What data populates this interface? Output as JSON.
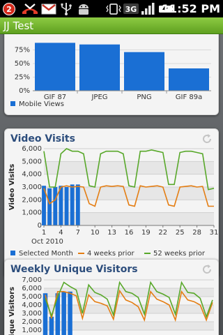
{
  "status_bar": {
    "notification_count": "2",
    "network_type": "3G",
    "time": "11:52 PM",
    "icons": [
      "notification-badge-icon",
      "missed-call-icon",
      "gmail-icon",
      "usb-icon",
      "android-debug-icon",
      "vibrate-icon",
      "3g-icon",
      "signal-icon",
      "battery-icon"
    ]
  },
  "app": {
    "title": "JJ Test"
  },
  "cards": {
    "mobile_views": {
      "legend": "Mobile Views"
    },
    "video_visits": {
      "title": "Video Visits",
      "month_label": "Oct 2010",
      "legend": [
        "Selected Month",
        "4 weeks prior",
        "52 weeks prior"
      ]
    },
    "weekly_visitors": {
      "title": "Weekly Unique Visitors"
    }
  },
  "colors": {
    "bar_blue": "#1a6fd4",
    "orange": "#e47d12",
    "green": "#58a82a",
    "title_blue": "#2c4d7c",
    "app_bar_green": "#6fb22b"
  },
  "chart_data": [
    {
      "type": "bar",
      "categories": [
        "GIF 87",
        "JPEG",
        "PNG",
        "GIF 89a"
      ],
      "series": [
        {
          "name": "Mobile Views",
          "values": [
            88,
            85,
            71,
            41
          ]
        }
      ],
      "yticks": [
        "0%",
        "25%",
        "50%",
        "75%"
      ],
      "ylim": [
        0,
        100
      ],
      "legend": "bottom-left"
    },
    {
      "type": "line",
      "title": "Video Visits",
      "ylabel": "Video Visits",
      "xlabel": "Oct 2010",
      "x": [
        1,
        2,
        3,
        4,
        5,
        6,
        7,
        8,
        9,
        10,
        11,
        12,
        13,
        14,
        15,
        16,
        17,
        18,
        19,
        20,
        21,
        22,
        23,
        24,
        25,
        26,
        27,
        28,
        29,
        30,
        31
      ],
      "xticks": [
        "1",
        "4",
        "7",
        "10",
        "13",
        "16",
        "19",
        "22",
        "25",
        "28",
        "31"
      ],
      "yticks": [
        "0",
        "1,000",
        "2,000",
        "3,000",
        "4,000",
        "5,000",
        "6,000"
      ],
      "ylim": [
        0,
        6000
      ],
      "series": [
        {
          "name": "Selected Month",
          "kind": "bar",
          "values": [
            3100,
            2900,
            3000,
            3100,
            3000,
            3200,
            3200
          ]
        },
        {
          "name": "4 weeks prior",
          "kind": "line",
          "values": [
            2900,
            1700,
            2000,
            3000,
            3100,
            3000,
            3050,
            3000,
            1700,
            1500,
            3000,
            3100,
            3050,
            3100,
            3050,
            1600,
            1500,
            3100,
            3000,
            3050,
            3100,
            3000,
            1600,
            1500,
            3000,
            3050,
            3100,
            3000,
            3050,
            1500,
            1500
          ]
        },
        {
          "name": "52 weeks prior",
          "kind": "line",
          "values": [
            5800,
            3000,
            3000,
            5600,
            6000,
            5800,
            5800,
            5600,
            3100,
            3000,
            5600,
            5800,
            5800,
            5800,
            5600,
            3100,
            3000,
            5800,
            5800,
            5900,
            5800,
            5700,
            3200,
            3200,
            5700,
            5800,
            5800,
            5700,
            5600,
            2800,
            2900
          ]
        }
      ],
      "legend": "bottom"
    },
    {
      "type": "line",
      "title": "Weekly Unique Visitors",
      "ylabel": "Unique Visitors",
      "yticks": [
        "1,000",
        "2,000",
        "3,000",
        "4,000",
        "5,000",
        "6,000",
        "7,000"
      ],
      "ylim": [
        0,
        7000
      ],
      "series": [
        {
          "name": "Selected Month",
          "kind": "bar",
          "values": [
            5400,
            2600,
            5400,
            5600,
            5600
          ]
        },
        {
          "name": "4 weeks prior",
          "kind": "line",
          "values": [
            5200,
            2400,
            5600,
            5600,
            5400,
            5100,
            2400,
            5200,
            4400,
            4200,
            3900,
            2300,
            5700,
            4600,
            4300,
            3800,
            2200,
            5600,
            4700,
            4400,
            4000,
            2200,
            5600,
            4600,
            4400,
            4000,
            2200,
            4300
          ]
        },
        {
          "name": "52 weeks prior",
          "kind": "line",
          "values": [
            4800,
            2700,
            5000,
            6700,
            6200,
            5800,
            3000,
            6400,
            5500,
            5200,
            4700,
            2800,
            6700,
            5600,
            5400,
            4900,
            2900,
            6700,
            5600,
            5300,
            4900,
            2900,
            6700,
            5500,
            5400,
            4800,
            2600,
            4600
          ]
        }
      ]
    }
  ]
}
